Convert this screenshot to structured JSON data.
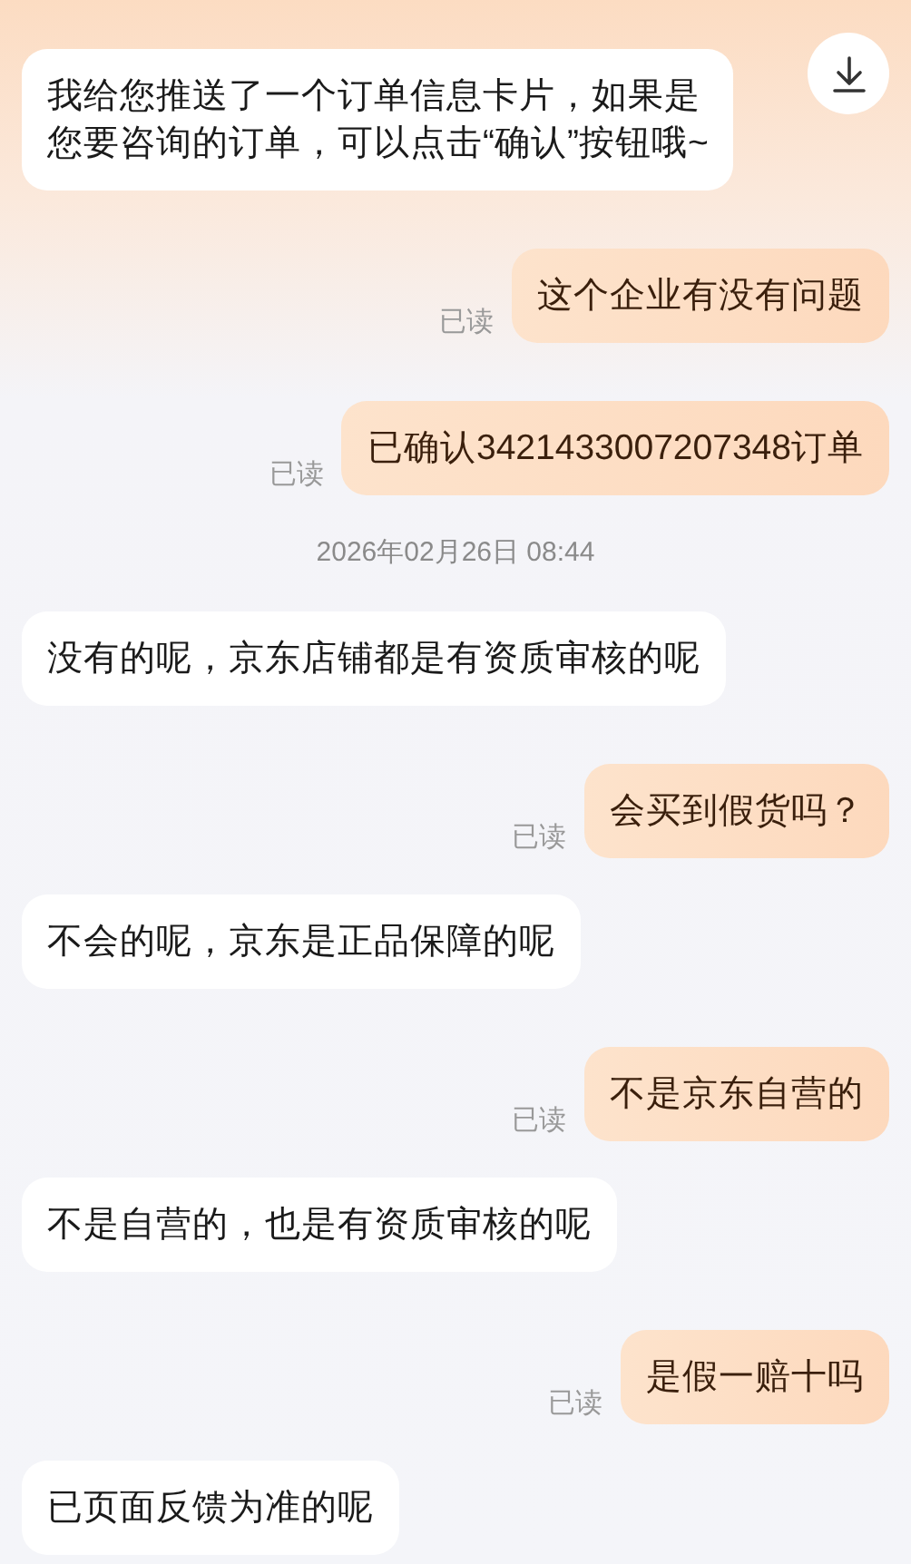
{
  "messages": [
    {
      "kind": "agent",
      "lines": [
        "我给您推送了一个订单信息卡片，如果是",
        "您要咨询的订单，可以点击“确认”按钮哦~"
      ]
    },
    {
      "kind": "user",
      "lines": [
        "这个企业有没有问题"
      ],
      "receipt": "已读"
    },
    {
      "kind": "user",
      "lines": [
        "已确认3421433007207348订单"
      ],
      "receipt": "已读"
    },
    {
      "kind": "time",
      "lines": [
        "2026年02月26日 08:44"
      ]
    },
    {
      "kind": "agent",
      "lines": [
        "没有的呢，京东店铺都是有资质审核的呢"
      ]
    },
    {
      "kind": "user",
      "lines": [
        "会买到假货吗？"
      ],
      "receipt": "已读"
    },
    {
      "kind": "agent",
      "lines": [
        "不会的呢，京东是正品保障的呢"
      ]
    },
    {
      "kind": "user",
      "lines": [
        "不是京东自营的"
      ],
      "receipt": "已读"
    },
    {
      "kind": "agent",
      "lines": [
        "不是自营的，也是有资质审核的呢"
      ]
    },
    {
      "kind": "user",
      "lines": [
        "是假一赔十吗"
      ],
      "receipt": "已读"
    },
    {
      "kind": "agent",
      "lines": [
        "已页面反馈为准的呢"
      ]
    }
  ]
}
